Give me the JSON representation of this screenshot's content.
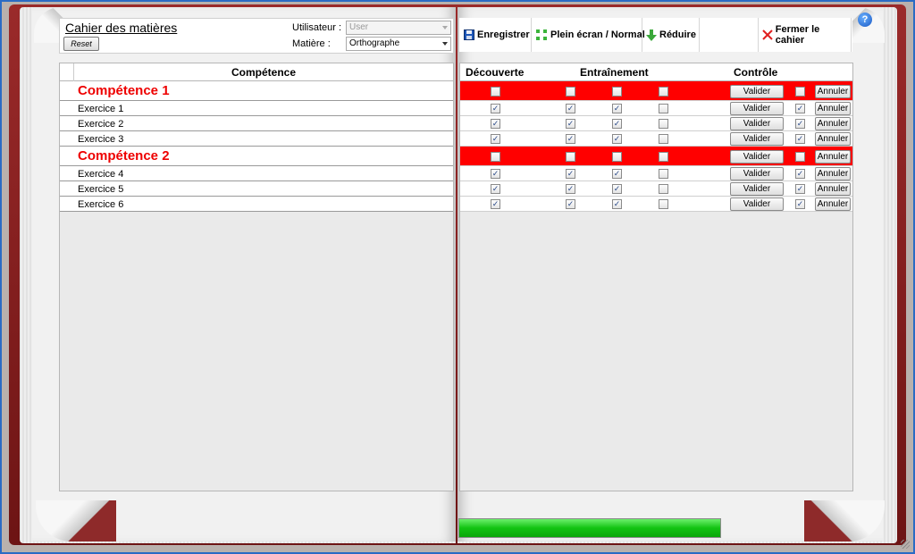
{
  "left_header": {
    "title": "Cahier des matières",
    "reset_label": "Reset",
    "user_label": "Utilisateur :",
    "user_value": "User",
    "subject_label": "Matière :",
    "subject_value": "Orthographe"
  },
  "toolbar": {
    "save_label": "Enregistrer",
    "fullscreen_label": "Plein écran / Normal",
    "minimize_label": "Réduire",
    "close_label": "Fermer le cahier",
    "help_label": "?"
  },
  "left_table": {
    "header": "Compétence",
    "rows": [
      {
        "label": "Compétence 1",
        "type": "competence"
      },
      {
        "label": "Exercice 1",
        "type": "exercise"
      },
      {
        "label": "Exercice 2",
        "type": "exercise"
      },
      {
        "label": "Exercice 3",
        "type": "exercise"
      },
      {
        "label": "Compétence 2",
        "type": "competence"
      },
      {
        "label": "Exercice 4",
        "type": "exercise"
      },
      {
        "label": "Exercice 5",
        "type": "exercise"
      },
      {
        "label": "Exercice 6",
        "type": "exercise"
      }
    ]
  },
  "right_table": {
    "headers": [
      "Découverte",
      "Entraînement",
      "Contrôle"
    ],
    "validate_label": "Valider",
    "cancel_label": "Annuler",
    "rows": [
      {
        "checks": [
          false,
          false,
          false,
          false
        ],
        "control": false,
        "red": true
      },
      {
        "checks": [
          true,
          true,
          true,
          false
        ],
        "control": true,
        "red": false
      },
      {
        "checks": [
          true,
          true,
          true,
          false
        ],
        "control": true,
        "red": false
      },
      {
        "checks": [
          true,
          true,
          true,
          false
        ],
        "control": true,
        "red": false
      },
      {
        "checks": [
          false,
          false,
          false,
          false
        ],
        "control": false,
        "red": true
      },
      {
        "checks": [
          true,
          true,
          true,
          false
        ],
        "control": true,
        "red": false
      },
      {
        "checks": [
          true,
          true,
          true,
          false
        ],
        "control": true,
        "red": false
      },
      {
        "checks": [
          true,
          true,
          true,
          false
        ],
        "control": true,
        "red": false
      }
    ]
  },
  "progress": {
    "percent": 100,
    "color": "#12c312"
  },
  "colors": {
    "competence_text": "#ee0000",
    "competence_row": "#ff0000",
    "cover": "#8b1e1e"
  }
}
